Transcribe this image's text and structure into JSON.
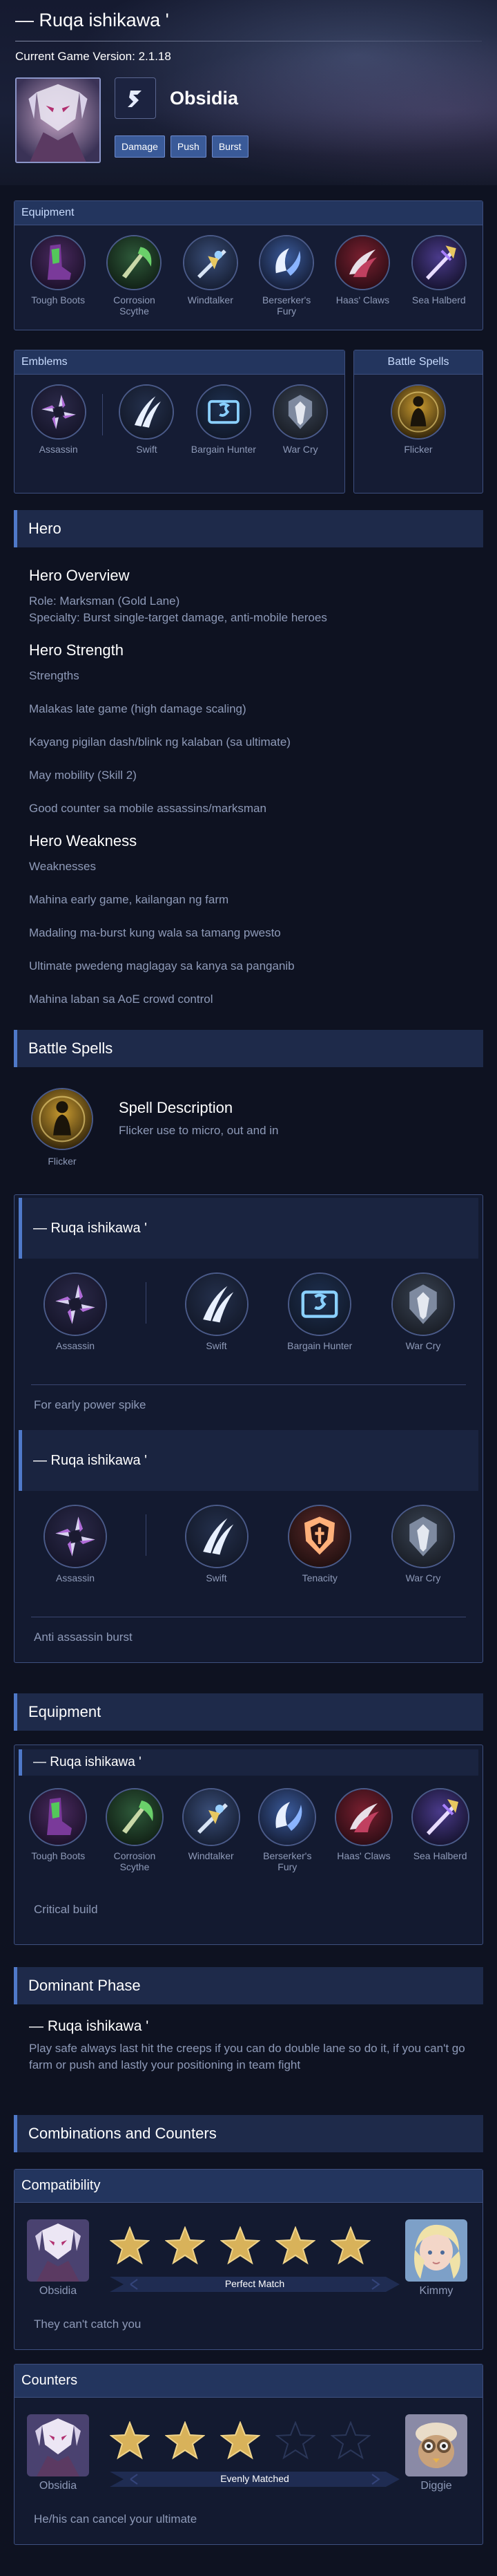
{
  "header": {
    "title": "— Ruqa ishikawa '",
    "version": "Current Game Version: 2.1.18",
    "hero_name": "Obsidia",
    "tags": [
      "Damage",
      "Push",
      "Burst"
    ]
  },
  "equipment_panel": {
    "title": "Equipment",
    "items": [
      {
        "label": "Tough Boots",
        "icon": "boots-icon"
      },
      {
        "label": "Corrosion Scythe",
        "icon": "scythe-icon"
      },
      {
        "label": "Windtalker",
        "icon": "windtalker-icon"
      },
      {
        "label": "Berserker's Fury",
        "icon": "berserker-icon"
      },
      {
        "label": "Haas' Claws",
        "icon": "claws-icon"
      },
      {
        "label": "Sea Halberd",
        "icon": "halberd-icon"
      }
    ]
  },
  "emblems_panel": {
    "title": "Emblems",
    "items": [
      {
        "label": "Assassin",
        "icon": "assassin-emblem-icon"
      },
      {
        "label": "Swift",
        "icon": "swift-icon"
      },
      {
        "label": "Bargain Hunter",
        "icon": "bargain-hunter-icon"
      },
      {
        "label": "War Cry",
        "icon": "war-cry-icon"
      }
    ]
  },
  "battle_spells_panel": {
    "title": "Battle Spells",
    "items": [
      {
        "label": "Flicker",
        "icon": "flicker-icon"
      }
    ]
  },
  "hero_section": {
    "title": "Hero",
    "overview_title": "Hero Overview",
    "role": "Role: Marksman (Gold Lane)",
    "specialty": "Specialty: Burst single-target damage, anti-mobile heroes",
    "strength_title": "Hero Strength",
    "strengths_label": "Strengths",
    "strengths": [
      "Malakas late game (high damage scaling)",
      "Kayang pigilan dash/blink ng kalaban (sa ultimate)",
      "May mobility (Skill 2)",
      "Good counter sa mobile assassins/marksman"
    ],
    "weakness_title": "Hero Weakness",
    "weaknesses_label": "Weaknesses",
    "weaknesses": [
      "Mahina early game, kailangan ng farm",
      "Madaling ma-burst kung wala sa tamang pwesto",
      "Ultimate pwedeng maglagay sa kanya sa panganib",
      "Mahina laban sa AoE crowd control"
    ]
  },
  "battle_spells_section": {
    "title": "Battle Spells",
    "spell_label": "Flicker",
    "desc_title": "Spell Description",
    "desc_text": "Flicker use to micro, out and in"
  },
  "emblem_builds": [
    {
      "author": "— Ruqa ishikawa '",
      "items": [
        {
          "label": "Assassin",
          "icon": "assassin-emblem-icon"
        },
        {
          "label": "Swift",
          "icon": "swift-icon"
        },
        {
          "label": "Bargain Hunter",
          "icon": "bargain-hunter-icon"
        },
        {
          "label": "War Cry",
          "icon": "war-cry-icon"
        }
      ],
      "note": "For early power spike"
    },
    {
      "author": "— Ruqa ishikawa '",
      "items": [
        {
          "label": "Assassin",
          "icon": "assassin-emblem-icon"
        },
        {
          "label": "Swift",
          "icon": "swift-icon"
        },
        {
          "label": "Tenacity",
          "icon": "tenacity-icon"
        },
        {
          "label": "War Cry",
          "icon": "war-cry-icon"
        }
      ],
      "note": "Anti assassin burst"
    }
  ],
  "equipment_section": {
    "title": "Equipment",
    "author": "— Ruqa ishikawa '",
    "items": [
      {
        "label": "Tough Boots",
        "icon": "boots-icon"
      },
      {
        "label": "Corrosion Scythe",
        "icon": "scythe-icon"
      },
      {
        "label": "Windtalker",
        "icon": "windtalker-icon"
      },
      {
        "label": "Berserker's Fury",
        "icon": "berserker-icon"
      },
      {
        "label": "Haas' Claws",
        "icon": "claws-icon"
      },
      {
        "label": "Sea Halberd",
        "icon": "halberd-icon"
      }
    ],
    "note": "Critical build"
  },
  "dominant_phase": {
    "title": "Dominant Phase",
    "author": "— Ruqa ishikawa '",
    "text": "Play safe always last hit the creeps if you can do double lane so do it, if you can't go farm or push and lastly your positioning in team fight"
  },
  "combos": {
    "title": "Combinations and Counters",
    "compatibility": {
      "title": "Compatibility",
      "left_hero": "Obsidia",
      "right_hero": "Kimmy",
      "rating": 5,
      "max_rating": 5,
      "verdict": "Perfect Match",
      "note": "They can't catch you"
    },
    "counters": {
      "title": "Counters",
      "left_hero": "Obsidia",
      "right_hero": "Diggie",
      "rating": 3,
      "max_rating": 5,
      "verdict": "Evenly Matched",
      "note": "He/his can cancel your ultimate"
    }
  },
  "colors": {
    "accent": "#4f79c9",
    "panel": "#151c34",
    "star": "#d8b25a"
  }
}
